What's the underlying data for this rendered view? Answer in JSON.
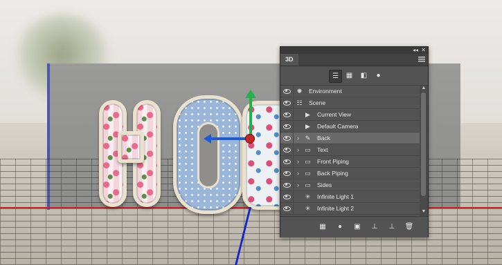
{
  "canvas": {
    "axis_colors": {
      "x": "#1b5cd6",
      "y": "#21b24a",
      "z": "#1428c8",
      "ground_red": "#d62020"
    }
  },
  "panel": {
    "tab_label": "3D",
    "collapse_glyph": "◂◂",
    "close_glyph": "✕",
    "filter_buttons": [
      {
        "name": "whole-scene-filter-icon",
        "glyph": "☰",
        "active": true
      },
      {
        "name": "meshes-filter-icon",
        "glyph": "▦",
        "active": false
      },
      {
        "name": "materials-filter-icon",
        "glyph": "◧",
        "active": false
      },
      {
        "name": "lights-filter-icon",
        "glyph": "●",
        "active": false
      }
    ],
    "layers": [
      {
        "label": "Environment",
        "icon": "environment-icon",
        "glyph": "✺",
        "chevron": false,
        "indent": 0,
        "selected": false
      },
      {
        "label": "Scene",
        "icon": "scene-icon",
        "glyph": "☷",
        "chevron": false,
        "indent": 0,
        "selected": false
      },
      {
        "label": "Current View",
        "icon": "camera-icon",
        "glyph": "▶",
        "chevron": false,
        "indent": 1,
        "selected": false
      },
      {
        "label": "Default Camera",
        "icon": "camera-icon",
        "glyph": "▶",
        "chevron": false,
        "indent": 1,
        "selected": false
      },
      {
        "label": "Back",
        "icon": "mesh-icon",
        "glyph": "✎",
        "chevron": true,
        "indent": 1,
        "selected": true
      },
      {
        "label": "Text",
        "icon": "folder-icon",
        "glyph": "▭",
        "chevron": true,
        "indent": 1,
        "selected": false
      },
      {
        "label": "Front Piping",
        "icon": "folder-icon",
        "glyph": "▭",
        "chevron": true,
        "indent": 1,
        "selected": false
      },
      {
        "label": "Back Piping",
        "icon": "folder-icon",
        "glyph": "▭",
        "chevron": true,
        "indent": 1,
        "selected": false
      },
      {
        "label": "Sides",
        "icon": "folder-icon",
        "glyph": "▭",
        "chevron": true,
        "indent": 1,
        "selected": false
      },
      {
        "label": "Infinite Light 1",
        "icon": "light-icon",
        "glyph": "✳",
        "chevron": false,
        "indent": 1,
        "selected": false
      },
      {
        "label": "Infinite Light 2",
        "icon": "light-icon",
        "glyph": "✳",
        "chevron": false,
        "indent": 1,
        "selected": false
      }
    ],
    "bottom_buttons": [
      {
        "name": "add-mesh-icon",
        "glyph": "▦"
      },
      {
        "name": "add-light-icon",
        "glyph": "●"
      },
      {
        "name": "render-icon",
        "glyph": "▣"
      },
      {
        "name": "drop-to-plane-icon",
        "glyph": "⊥"
      },
      {
        "name": "new-constraint-icon",
        "glyph": "⊥"
      },
      {
        "name": "delete-icon",
        "glyph": "🗑"
      }
    ]
  }
}
